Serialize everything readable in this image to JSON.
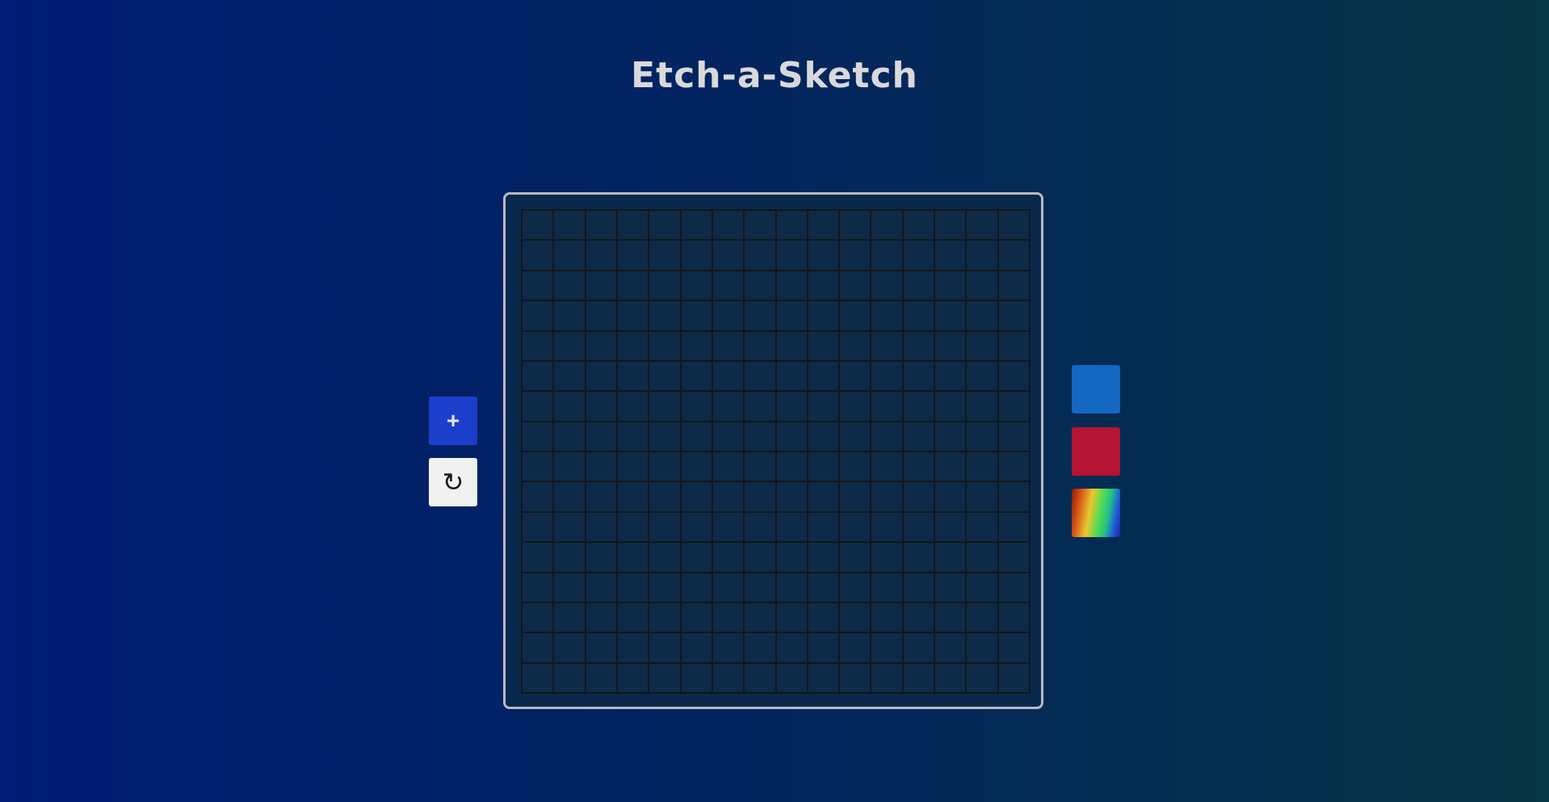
{
  "header": {
    "title": "Etch-a-Sketch"
  },
  "controls": {
    "add_label": "+",
    "reset_label": "↻"
  },
  "board": {
    "rows": 16,
    "columns": 16,
    "cell_color": "#0d2a48",
    "line_color": "#141618",
    "frame_color": "#b9b9c0"
  },
  "colors": {
    "options": [
      {
        "name": "blue",
        "value": "#1467c2"
      },
      {
        "name": "red",
        "value": "#b51332"
      },
      {
        "name": "rainbow",
        "value": "rainbow-gradient"
      }
    ],
    "background_start": "#001b74",
    "background_end": "#063544",
    "add_button_color": "#1b3fcc",
    "reset_button_color": "#f1f1f2"
  }
}
